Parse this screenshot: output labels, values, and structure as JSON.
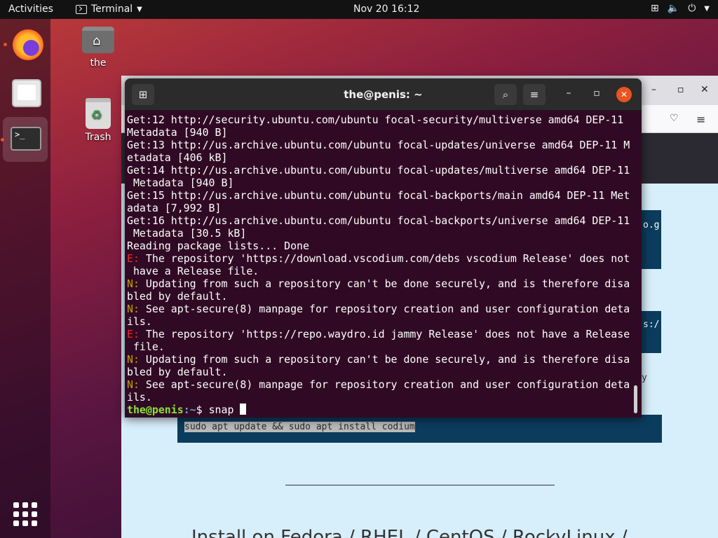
{
  "topbar": {
    "activities": "Activities",
    "app_name": "Terminal",
    "clock": "Nov 20  16:12",
    "tray_icons": [
      "network-icon",
      "volume-icon",
      "power-icon",
      "chevron-down-icon"
    ]
  },
  "dock": {
    "items": [
      "firefox",
      "files",
      "terminal"
    ],
    "show_apps": "show-applications-icon"
  },
  "desktop": {
    "home_label": "the",
    "trash_label": "Trash"
  },
  "browser": {
    "command": "sudo apt update && sudo apt install codium",
    "heading": "Install on Fedora / RHEL / CentOS / RockyLinux /",
    "fragment_1": "o.g",
    "fragment_2": "s:/",
    "fragment_3": "y"
  },
  "terminal": {
    "title": "the@penis: ~",
    "lines": [
      {
        "text": "Get:12 http://security.ubuntu.com/ubuntu focal-security/multiverse amd64 DEP-11"
      },
      {
        "text": "Metadata [940 B]"
      },
      {
        "text": "Get:13 http://us.archive.ubuntu.com/ubuntu focal-updates/universe amd64 DEP-11 M"
      },
      {
        "text": "etadata [406 kB]"
      },
      {
        "text": "Get:14 http://us.archive.ubuntu.com/ubuntu focal-updates/multiverse amd64 DEP-11"
      },
      {
        "text": " Metadata [940 B]"
      },
      {
        "text": "Get:15 http://us.archive.ubuntu.com/ubuntu focal-backports/main amd64 DEP-11 Met"
      },
      {
        "text": "adata [7,992 B]"
      },
      {
        "text": "Get:16 http://us.archive.ubuntu.com/ubuntu focal-backports/universe amd64 DEP-11"
      },
      {
        "text": " Metadata [30.5 kB]"
      },
      {
        "text": "Reading package lists... Done"
      },
      {
        "prefix": "E:",
        "kind": "E",
        "text": " The repository 'https://download.vscodium.com/debs vscodium Release' does not"
      },
      {
        "text": " have a Release file."
      },
      {
        "prefix": "N:",
        "kind": "N",
        "text": " Updating from such a repository can't be done securely, and is therefore disa"
      },
      {
        "text": "bled by default."
      },
      {
        "prefix": "N:",
        "kind": "N",
        "text": " See apt-secure(8) manpage for repository creation and user configuration deta"
      },
      {
        "text": "ils."
      },
      {
        "prefix": "E:",
        "kind": "E",
        "text": " The repository 'https://repo.waydro.id jammy Release' does not have a Release"
      },
      {
        "text": " file."
      },
      {
        "prefix": "N:",
        "kind": "N",
        "text": " Updating from such a repository can't be done securely, and is therefore disa"
      },
      {
        "text": "bled by default."
      },
      {
        "prefix": "N:",
        "kind": "N",
        "text": " See apt-secure(8) manpage for repository creation and user configuration deta"
      },
      {
        "text": "ils."
      }
    ],
    "prompt_user": "the@penis",
    "prompt_path": ":~",
    "prompt_symbol": "$ ",
    "input": "snap "
  }
}
